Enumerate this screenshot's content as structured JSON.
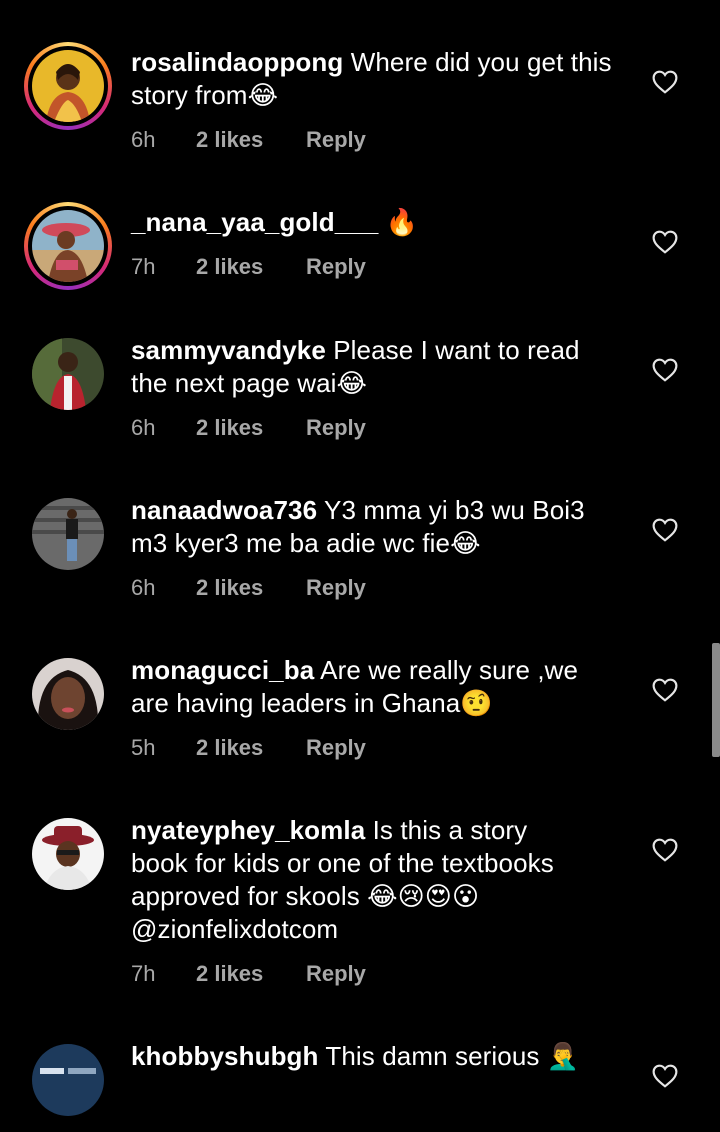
{
  "comments": [
    {
      "username": "rosalindaoppong",
      "text": "Where did you get this\nstory from😂",
      "time": "6h",
      "likes": "2 likes",
      "reply": "Reply",
      "story_ring": true,
      "avatar_icon": "woman-portrait-avatar"
    },
    {
      "username": "_nana_yaa_gold___",
      "text": "🔥",
      "time": "7h",
      "likes": "2 likes",
      "reply": "Reply",
      "story_ring": true,
      "avatar_icon": "beach-portrait-avatar"
    },
    {
      "username": "sammyvandyke",
      "text": "Please I want to read\nthe next page wai😂",
      "time": "6h",
      "likes": "2 likes",
      "reply": "Reply",
      "story_ring": false,
      "avatar_icon": "man-portrait-avatar"
    },
    {
      "username": "nanaadwoa736",
      "text": "Y3 mma yi b3 wu Boi3\nm3 kyer3 me ba adie wc fie😂",
      "time": "6h",
      "likes": "2 likes",
      "reply": "Reply",
      "story_ring": false,
      "avatar_icon": "woman-standing-avatar"
    },
    {
      "username": "monagucci_ba",
      "text": "Are we really sure ,we\nare having leaders in Ghana🤨",
      "time": "5h",
      "likes": "2 likes",
      "reply": "Reply",
      "story_ring": false,
      "avatar_icon": "woman-closeup-avatar"
    },
    {
      "username": "nyateyphey_komla",
      "text": "Is this a story\nbook for kids or one of the textbooks\napproved for skools 😂😢😍😮\n@zionfelixdotcom",
      "time": "7h",
      "likes": "2 likes",
      "reply": "Reply",
      "story_ring": false,
      "avatar_icon": "man-red-hat-avatar"
    },
    {
      "username": "khobbyshubgh",
      "text": "This damn serious 🤦‍♂️",
      "time": "",
      "likes": "",
      "reply": "",
      "story_ring": false,
      "avatar_icon": "blue-logo-avatar"
    }
  ],
  "colors": {
    "background": "#000000",
    "text": "#ffffff",
    "meta": "#a8a8a8"
  }
}
